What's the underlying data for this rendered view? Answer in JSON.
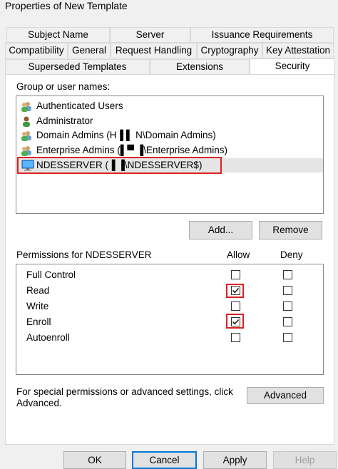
{
  "window": {
    "title": "Properties of New Template"
  },
  "tabs": {
    "row1": [
      "Subject Name",
      "Server",
      "Issuance Requirements"
    ],
    "row2": [
      "Compatibility",
      "General",
      "Request Handling",
      "Cryptography",
      "Key Attestation"
    ],
    "row3": [
      "Superseded Templates",
      "Extensions",
      "Security"
    ],
    "active": "Security"
  },
  "security": {
    "group_label": "Group or user names:",
    "users": [
      {
        "name": "Authenticated Users",
        "icon": "user-group-icon"
      },
      {
        "name": "Administrator",
        "icon": "user-icon"
      },
      {
        "name": "Domain Admins (H▐  ▌ N\\Domain Admins)",
        "icon": "user-group-icon"
      },
      {
        "name": "Enterprise Admins (▌▀    ▐\\Enterprise Admins)",
        "icon": "user-group-icon"
      },
      {
        "name": "NDESSERVER (▐     ▐\\NDESSERVER$)",
        "icon": "computer-icon",
        "selected": true
      }
    ],
    "add_label": "Add...",
    "remove_label": "Remove",
    "permissions_label": "Permissions for NDESSERVER",
    "allow_label": "Allow",
    "deny_label": "Deny",
    "permissions": [
      {
        "name": "Full Control",
        "allow": false,
        "deny": false
      },
      {
        "name": "Read",
        "allow": true,
        "deny": false
      },
      {
        "name": "Write",
        "allow": false,
        "deny": false
      },
      {
        "name": "Enroll",
        "allow": true,
        "deny": false
      },
      {
        "name": "Autoenroll",
        "allow": false,
        "deny": false
      }
    ],
    "advanced_text_1": "For special permissions or advanced settings, click",
    "advanced_text_2": "Advanced.",
    "advanced_label": "Advanced"
  },
  "footer": {
    "ok": "OK",
    "cancel": "Cancel",
    "apply": "Apply",
    "help": "Help"
  },
  "colors": {
    "highlight": "#e02020",
    "focus": "#0078d7"
  }
}
